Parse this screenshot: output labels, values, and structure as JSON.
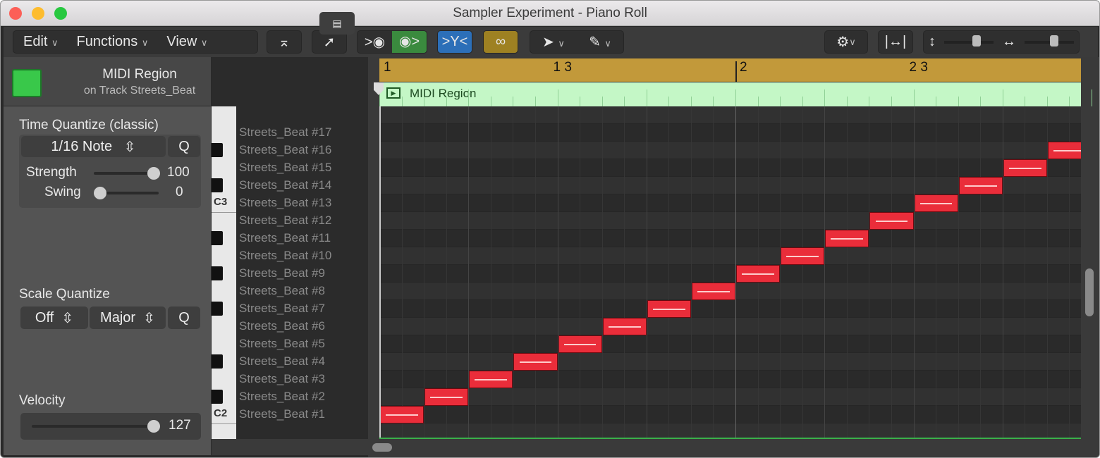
{
  "window": {
    "title": "Sampler Experiment - Piano Roll"
  },
  "toolbar": {
    "menus": [
      "Edit",
      "Functions",
      "View"
    ]
  },
  "inspector": {
    "region_title": "MIDI Region",
    "region_subtitle": "on Track Streets_Beat",
    "time_quantize": {
      "label": "Time Quantize (classic)",
      "value": "1/16 Note",
      "q": "Q",
      "strength_label": "Strength",
      "strength": 100,
      "swing_label": "Swing",
      "swing": 0
    },
    "scale_quantize": {
      "label": "Scale Quantize",
      "root": "Off",
      "scale": "Major",
      "q": "Q"
    },
    "velocity": {
      "label": "Velocity",
      "value": 127
    }
  },
  "keyboard": {
    "c3": "C3",
    "c2": "C2"
  },
  "ruler": {
    "marks": [
      "1",
      "1 3",
      "2",
      "2 3"
    ]
  },
  "region": {
    "name": "MIDI Region"
  },
  "notes_names": [
    "Streets_Beat #17",
    "Streets_Beat #16",
    "Streets_Beat #15",
    "Streets_Beat #14",
    "Streets_Beat #13",
    "Streets_Beat #12",
    "Streets_Beat #11",
    "Streets_Beat #10",
    "Streets_Beat #9",
    "Streets_Beat #8",
    "Streets_Beat #7",
    "Streets_Beat #6",
    "Streets_Beat #5",
    "Streets_Beat #4",
    "Streets_Beat #3",
    "Streets_Beat #2",
    "Streets_Beat #1"
  ],
  "notes": [
    {
      "pitch": 1,
      "start16": 0,
      "len16": 2
    },
    {
      "pitch": 2,
      "start16": 2,
      "len16": 2
    },
    {
      "pitch": 3,
      "start16": 4,
      "len16": 2
    },
    {
      "pitch": 4,
      "start16": 6,
      "len16": 2
    },
    {
      "pitch": 5,
      "start16": 8,
      "len16": 2
    },
    {
      "pitch": 6,
      "start16": 10,
      "len16": 2
    },
    {
      "pitch": 7,
      "start16": 12,
      "len16": 2
    },
    {
      "pitch": 8,
      "start16": 14,
      "len16": 2
    },
    {
      "pitch": 9,
      "start16": 16,
      "len16": 2
    },
    {
      "pitch": 10,
      "start16": 18,
      "len16": 2
    },
    {
      "pitch": 11,
      "start16": 20,
      "len16": 2
    },
    {
      "pitch": 12,
      "start16": 22,
      "len16": 2
    },
    {
      "pitch": 13,
      "start16": 24,
      "len16": 2
    },
    {
      "pitch": 14,
      "start16": 26,
      "len16": 2
    },
    {
      "pitch": 15,
      "start16": 28,
      "len16": 2
    },
    {
      "pitch": 16,
      "start16": 30,
      "len16": 2
    }
  ]
}
